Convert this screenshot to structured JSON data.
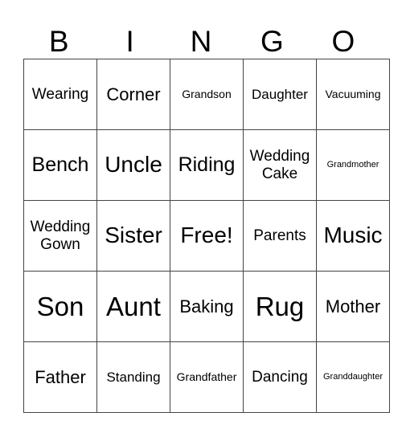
{
  "header": [
    "B",
    "I",
    "N",
    "G",
    "O"
  ],
  "rows": [
    [
      "Wearing",
      "Corner",
      "Grandson",
      "Daughter",
      "Vacuuming"
    ],
    [
      "Bench",
      "Uncle",
      "Riding",
      "Wedding Cake",
      "Grandmother"
    ],
    [
      "Wedding Gown",
      "Sister",
      "Free!",
      "Parents",
      "Music"
    ],
    [
      "Son",
      "Aunt",
      "Baking",
      "Rug",
      "Mother"
    ],
    [
      "Father",
      "Standing",
      "Grandfather",
      "Dancing",
      "Granddaughter"
    ]
  ]
}
